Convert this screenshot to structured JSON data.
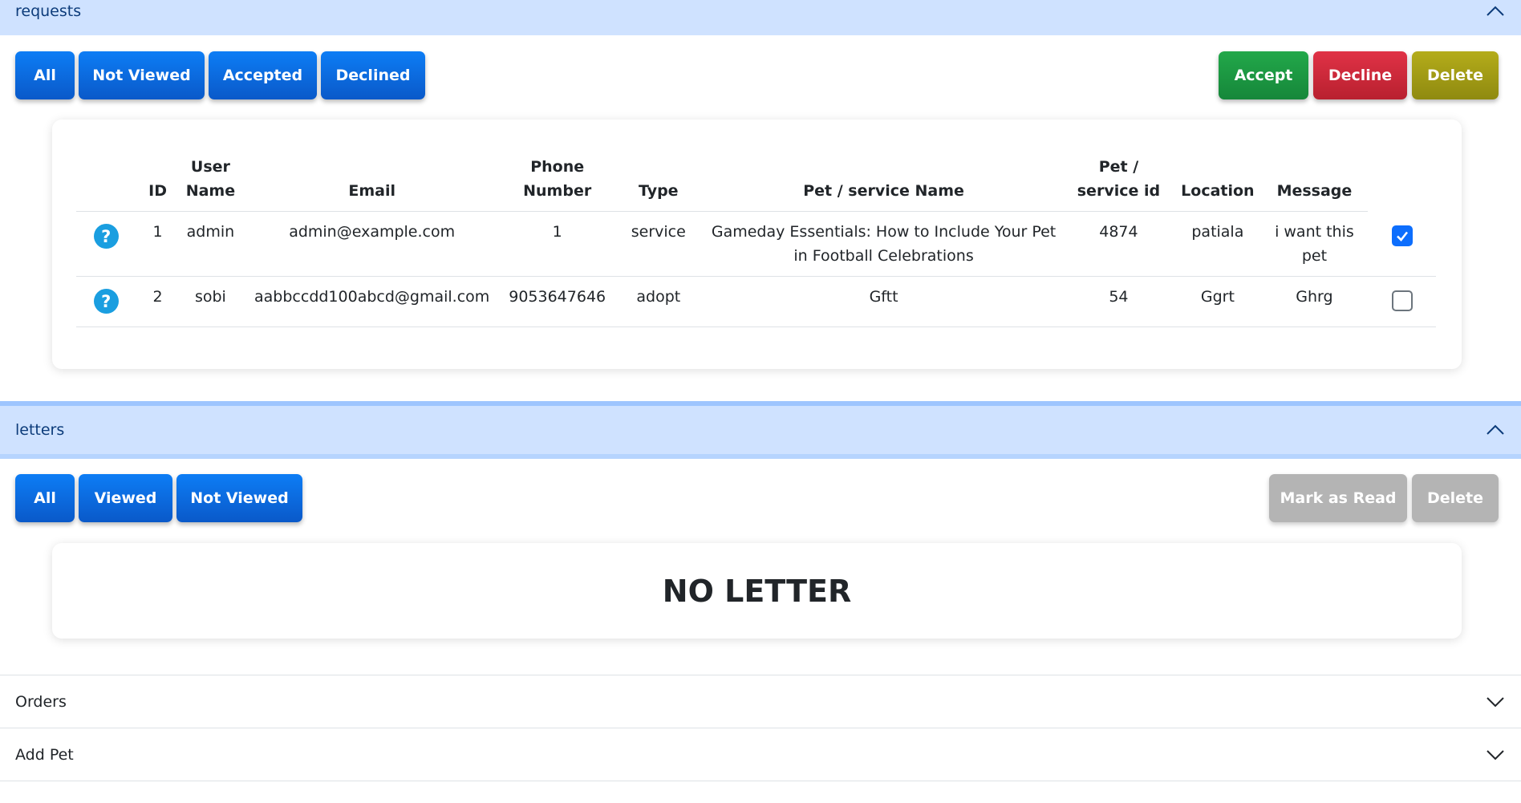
{
  "requests": {
    "header_label": "requests",
    "filters": [
      "All",
      "Not Viewed",
      "Accepted",
      "Declined"
    ],
    "actions": {
      "accept": "Accept",
      "decline": "Decline",
      "delete": "Delete"
    },
    "table": {
      "headers": [
        "",
        "ID",
        "User Name",
        "Email",
        "Phone Number",
        "Type",
        "Pet / service Name",
        "Pet / service id",
        "Location",
        "Message",
        ""
      ],
      "rows": [
        {
          "id": "1",
          "user_name": "admin",
          "email": "admin@example.com",
          "phone": "1",
          "type": "service",
          "pet_name": "Gameday Essentials: How to Include Your Pet in Football Celebrations",
          "pet_id": "4874",
          "location": "patiala",
          "message": "i want this pet",
          "checked": true
        },
        {
          "id": "2",
          "user_name": "sobi",
          "email": "aabbccdd100abcd@gmail.com",
          "phone": "9053647646",
          "type": "adopt",
          "pet_name": "Gftt",
          "pet_id": "54",
          "location": "Ggrt",
          "message": "Ghrg",
          "checked": false
        }
      ],
      "row_icon": "question-icon"
    }
  },
  "letters": {
    "header_label": "letters",
    "filters": [
      "All",
      "Viewed",
      "Not Viewed"
    ],
    "actions": {
      "mark_read": "Mark as Read",
      "delete": "Delete"
    },
    "empty_message": "NO LETTER"
  },
  "orders": {
    "header_label": "Orders"
  },
  "add_pet": {
    "header_label": "Add Pet"
  },
  "colors": {
    "header_open_bg": "#cfe2ff",
    "primary": "#0d6efd",
    "success": "#198754",
    "danger": "#dc3545",
    "olive": "#a39d15",
    "disabled": "#b4b4b4"
  }
}
